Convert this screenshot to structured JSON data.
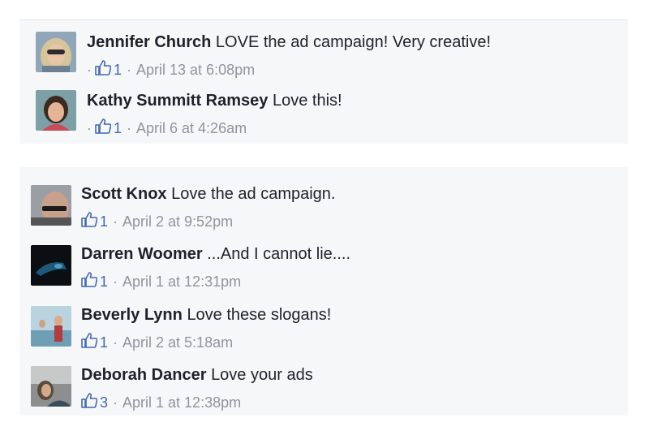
{
  "top_comments": [
    {
      "name": "Jennifer Church",
      "text": "LOVE the ad campaign! Very creative!",
      "likes": "1",
      "time": "April 13 at 6:08pm",
      "lead_dot": "·"
    },
    {
      "name": "Kathy Summitt Ramsey",
      "text": "Love this!",
      "likes": "1",
      "time": "April 6 at 4:26am",
      "lead_dot": "·"
    }
  ],
  "bottom_comments": [
    {
      "name": "Scott Knox",
      "text": "Love the ad campaign.",
      "likes": "1",
      "time": "April 2 at 9:52pm"
    },
    {
      "name": "Darren Woomer",
      "text": "...And I cannot lie....",
      "likes": "1",
      "time": "April 1 at 12:31pm"
    },
    {
      "name": "Beverly Lynn",
      "text": "Love these slogans!",
      "likes": "1",
      "time": "April 2 at 5:18am"
    },
    {
      "name": "Deborah Dancer",
      "text": "Love your ads",
      "likes": "3",
      "time": "April 1 at 12:38pm"
    }
  ],
  "separator": "·",
  "colors": {
    "link_blue": "#4267b2",
    "meta_gray": "#90949c",
    "panel_bg": "#f6f7f9",
    "text": "#1d2129"
  },
  "icons": {
    "like": "thumbs-up-icon"
  }
}
